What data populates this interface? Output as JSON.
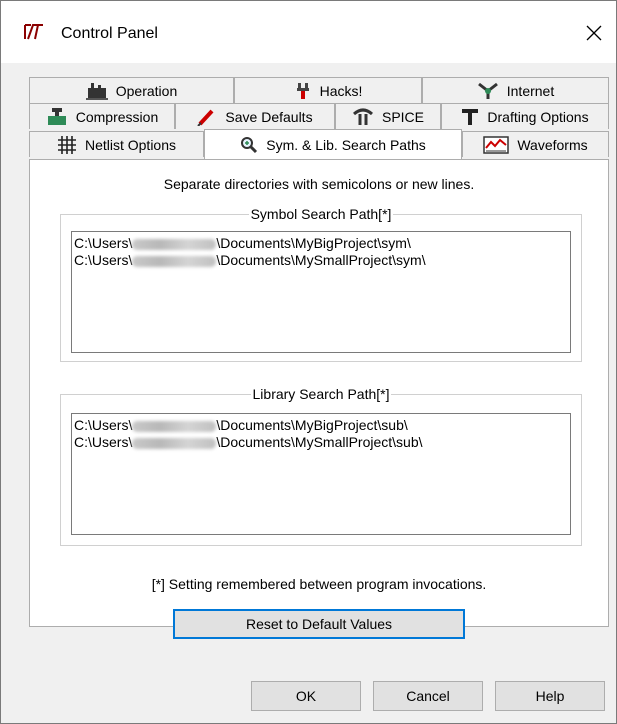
{
  "window": {
    "title": "Control Panel"
  },
  "tabs": {
    "row1": [
      {
        "label": "Operation",
        "icon": "plant-icon"
      },
      {
        "label": "Hacks!",
        "icon": "wrench-icon"
      },
      {
        "label": "Internet",
        "icon": "network-icon"
      }
    ],
    "row2": [
      {
        "label": "Compression",
        "icon": "compression-icon"
      },
      {
        "label": "Save Defaults",
        "icon": "probe-icon"
      },
      {
        "label": "SPICE",
        "icon": "spice-icon"
      },
      {
        "label": "Drafting Options",
        "icon": "tee-icon"
      }
    ],
    "row3": [
      {
        "label": "Netlist Options",
        "icon": "grid-icon"
      },
      {
        "label": "Sym. & Lib. Search Paths",
        "icon": "magnifier-icon",
        "active": true
      },
      {
        "label": "Waveforms",
        "icon": "waveform-icon"
      }
    ]
  },
  "panel": {
    "hint": "Separate directories with semicolons or new lines.",
    "symbol": {
      "legend": "Symbol Search Path[*]",
      "lines": [
        {
          "prefix": "C:\\Users\\",
          "suffix": "\\Documents\\MyBigProject\\sym\\"
        },
        {
          "prefix": "C:\\Users\\",
          "suffix": "\\Documents\\MySmallProject\\sym\\"
        }
      ]
    },
    "library": {
      "legend": "Library Search Path[*]",
      "lines": [
        {
          "prefix": "C:\\Users\\",
          "suffix": "\\Documents\\MyBigProject\\sub\\"
        },
        {
          "prefix": "C:\\Users\\",
          "suffix": "\\Documents\\MySmallProject\\sub\\"
        }
      ]
    },
    "footnote": "[*] Setting remembered between program invocations.",
    "reset_label": "Reset to Default Values"
  },
  "buttons": {
    "ok": "OK",
    "cancel": "Cancel",
    "help": "Help"
  },
  "colors": {
    "accent": "#0078d7",
    "icon_red": "#cc0000",
    "icon_green": "#2e8b57"
  }
}
